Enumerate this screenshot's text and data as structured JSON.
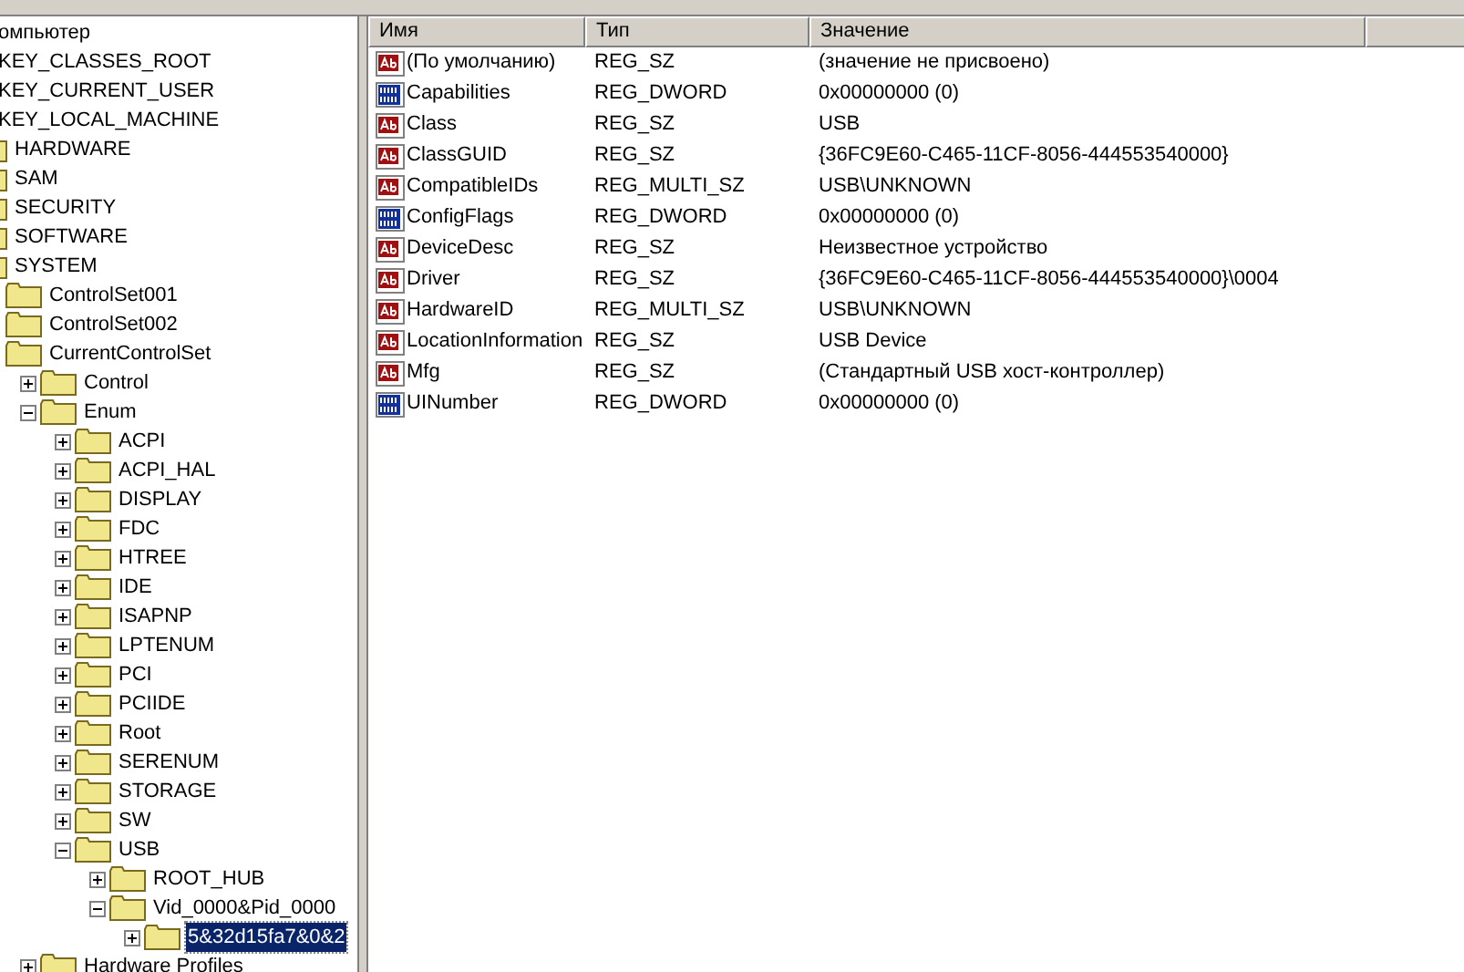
{
  "tree": [
    {
      "label": "омпьютер",
      "selected": false,
      "children": [
        {
          "label": "KEY_CLASSES_ROOT",
          "selected": false
        },
        {
          "label": "KEY_CURRENT_USER",
          "selected": false
        },
        {
          "label": "KEY_LOCAL_MACHINE",
          "selected": false,
          "children": [
            {
              "label": "HARDWARE",
              "selected": false
            },
            {
              "label": "SAM",
              "selected": false
            },
            {
              "label": "SECURITY",
              "selected": false
            },
            {
              "label": "SOFTWARE",
              "selected": false
            },
            {
              "label": "SYSTEM",
              "selected": false,
              "children": [
                {
                  "label": "ControlSet001",
                  "selected": false
                },
                {
                  "label": "ControlSet002",
                  "selected": false
                },
                {
                  "label": "CurrentControlSet",
                  "selected": false,
                  "children": [
                    {
                      "label": "Control",
                      "expanded": false,
                      "selected": false
                    },
                    {
                      "label": "Enum",
                      "expanded": true,
                      "selected": false,
                      "children": [
                        {
                          "label": "ACPI",
                          "expanded": false,
                          "selected": false
                        },
                        {
                          "label": "ACPI_HAL",
                          "expanded": false,
                          "selected": false
                        },
                        {
                          "label": "DISPLAY",
                          "expanded": false,
                          "selected": false
                        },
                        {
                          "label": "FDC",
                          "expanded": false,
                          "selected": false
                        },
                        {
                          "label": "HTREE",
                          "expanded": false,
                          "selected": false
                        },
                        {
                          "label": "IDE",
                          "expanded": false,
                          "selected": false
                        },
                        {
                          "label": "ISAPNP",
                          "expanded": false,
                          "selected": false
                        },
                        {
                          "label": "LPTENUM",
                          "expanded": false,
                          "selected": false
                        },
                        {
                          "label": "PCI",
                          "expanded": false,
                          "selected": false
                        },
                        {
                          "label": "PCIIDE",
                          "expanded": false,
                          "selected": false
                        },
                        {
                          "label": "Root",
                          "expanded": false,
                          "selected": false
                        },
                        {
                          "label": "SERENUM",
                          "expanded": false,
                          "selected": false
                        },
                        {
                          "label": "STORAGE",
                          "expanded": false,
                          "selected": false
                        },
                        {
                          "label": "SW",
                          "expanded": false,
                          "selected": false
                        },
                        {
                          "label": "USB",
                          "expanded": true,
                          "selected": false,
                          "children": [
                            {
                              "label": "ROOT_HUB",
                              "expanded": false,
                              "selected": false
                            },
                            {
                              "label": "Vid_0000&Pid_0000",
                              "expanded": true,
                              "selected": false,
                              "children": [
                                {
                                  "label": "5&32d15fa7&0&2",
                                  "expanded": false,
                                  "selected": true
                                }
                              ]
                            }
                          ]
                        }
                      ]
                    },
                    {
                      "label": "Hardware Profiles",
                      "expanded": false,
                      "selected": false
                    }
                  ]
                }
              ]
            }
          ]
        }
      ]
    }
  ],
  "table": {
    "columns": [
      "Имя",
      "Тип",
      "Значение"
    ],
    "rows": [
      {
        "kind": "string",
        "name": "(По умолчанию)",
        "type": "REG_SZ",
        "value": "(значение не присвоено)"
      },
      {
        "kind": "binary",
        "name": "Capabilities",
        "type": "REG_DWORD",
        "value": "0x00000000 (0)"
      },
      {
        "kind": "string",
        "name": "Class",
        "type": "REG_SZ",
        "value": "USB"
      },
      {
        "kind": "string",
        "name": "ClassGUID",
        "type": "REG_SZ",
        "value": "{36FC9E60-C465-11CF-8056-444553540000}"
      },
      {
        "kind": "string",
        "name": "CompatibleIDs",
        "type": "REG_MULTI_SZ",
        "value": "USB\\UNKNOWN"
      },
      {
        "kind": "binary",
        "name": "ConfigFlags",
        "type": "REG_DWORD",
        "value": "0x00000000 (0)"
      },
      {
        "kind": "string",
        "name": "DeviceDesc",
        "type": "REG_SZ",
        "value": "Неизвестное устройство"
      },
      {
        "kind": "string",
        "name": "Driver",
        "type": "REG_SZ",
        "value": "{36FC9E60-C465-11CF-8056-444553540000}\\0004"
      },
      {
        "kind": "string",
        "name": "HardwareID",
        "type": "REG_MULTI_SZ",
        "value": "USB\\UNKNOWN"
      },
      {
        "kind": "string",
        "name": "LocationInformation",
        "type": "REG_SZ",
        "value": "USB Device"
      },
      {
        "kind": "string",
        "name": "Mfg",
        "type": "REG_SZ",
        "value": "(Стандартный USB хост-контроллер)"
      },
      {
        "kind": "binary",
        "name": "UINumber",
        "type": "REG_DWORD",
        "value": "0x00000000 (0)"
      }
    ]
  }
}
